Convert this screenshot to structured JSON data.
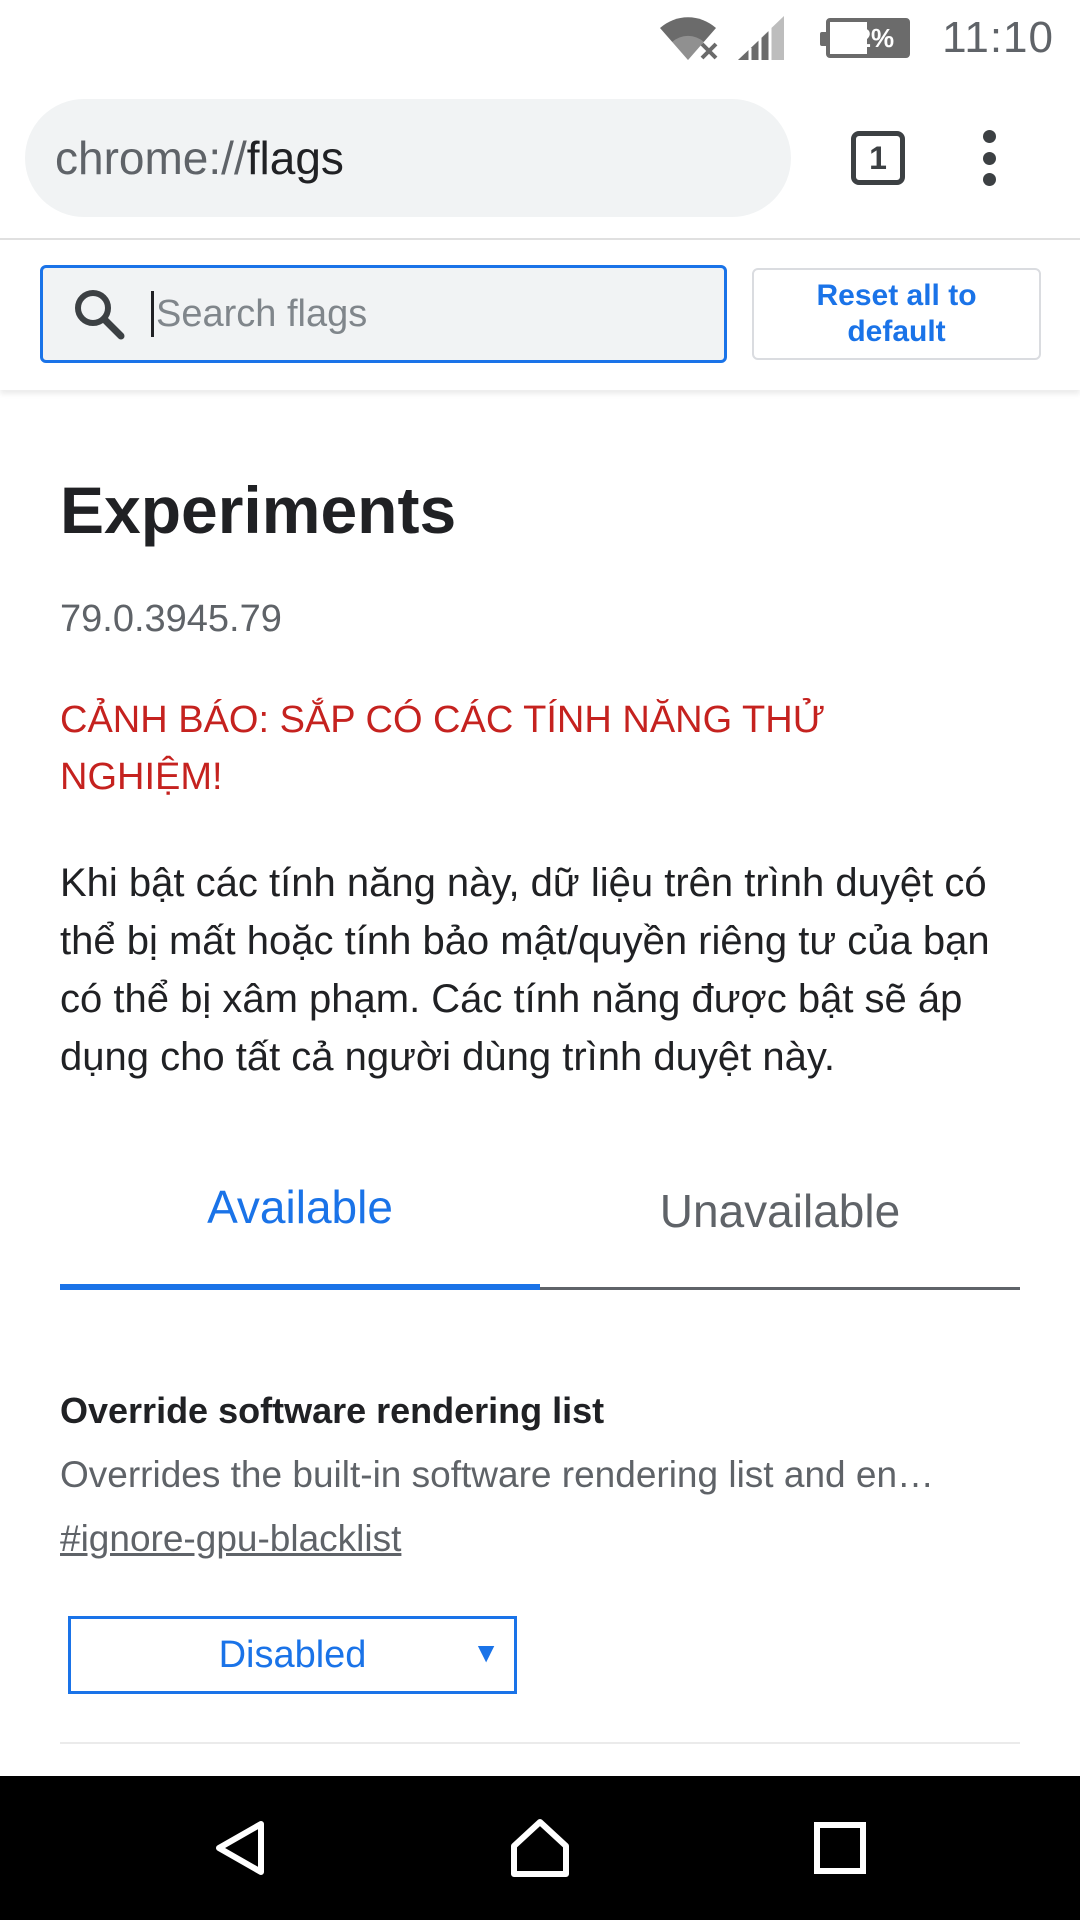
{
  "status_bar": {
    "battery": "52%",
    "time": "11:10",
    "icons": [
      "wifi-icon",
      "cell-signal-icon",
      "battery-icon"
    ]
  },
  "toolbar": {
    "url_scheme": "chrome://",
    "url_host": "flags",
    "tab_count": "1",
    "icons": [
      "tab-switcher-icon",
      "more-vert-icon"
    ]
  },
  "search": {
    "placeholder": "Search flags",
    "reset_label": "Reset all to default",
    "icon": "search-icon"
  },
  "page": {
    "title": "Experiments",
    "version": "79.0.3945.79",
    "warning": "CẢNH BÁO: SẮP CÓ CÁC TÍNH NĂNG THỬ NGHIỆM!",
    "description": "Khi bật các tính năng này, dữ liệu trên trình duyệt có thể bị mất hoặc tính bảo mật/quyền riêng tư của bạn có thể bị xâm phạm. Các tính năng được bật sẽ áp dụng cho tất cả người dùng trình duyệt này."
  },
  "tabs": [
    {
      "label": "Available",
      "selected": true
    },
    {
      "label": "Unavailable",
      "selected": false
    }
  ],
  "flags": [
    {
      "title": "Override software rendering list",
      "description": "Overrides the built-in software rendering list and en…",
      "link": "#ignore-gpu-blacklist",
      "value": "Disabled"
    }
  ],
  "nav_bar": {
    "icons": [
      "back-icon",
      "home-icon",
      "recents-icon"
    ]
  },
  "colors": {
    "accent": "#1a73e8",
    "warning": "#c5221f",
    "text": "#202124",
    "secondary_text": "#5f6368",
    "nav_bar": "#000000"
  }
}
